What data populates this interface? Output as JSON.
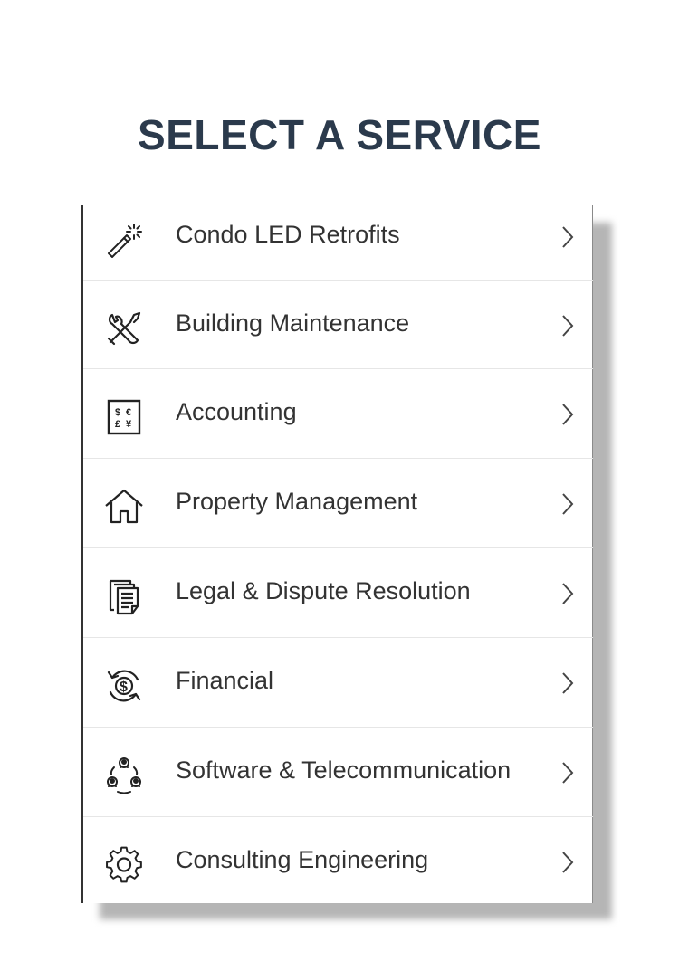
{
  "page": {
    "title": "SELECT A SERVICE"
  },
  "services": [
    {
      "label": "Condo LED Retrofits",
      "icon": "magic-wand-icon"
    },
    {
      "label": "Building Maintenance",
      "icon": "tools-icon"
    },
    {
      "label": "Accounting",
      "icon": "currency-icon"
    },
    {
      "label": "Property Management",
      "icon": "house-icon"
    },
    {
      "label": "Legal & Dispute Resolution",
      "icon": "documents-icon"
    },
    {
      "label": "Financial",
      "icon": "dollar-cycle-icon"
    },
    {
      "label": "Software & Telecommunication",
      "icon": "network-people-icon"
    },
    {
      "label": "Consulting Engineering",
      "icon": "gear-icon"
    }
  ],
  "colors": {
    "title": "#2b3a4c",
    "text": "#333333",
    "divider": "#e6e6e6",
    "shadow": "#b5b5b5"
  }
}
